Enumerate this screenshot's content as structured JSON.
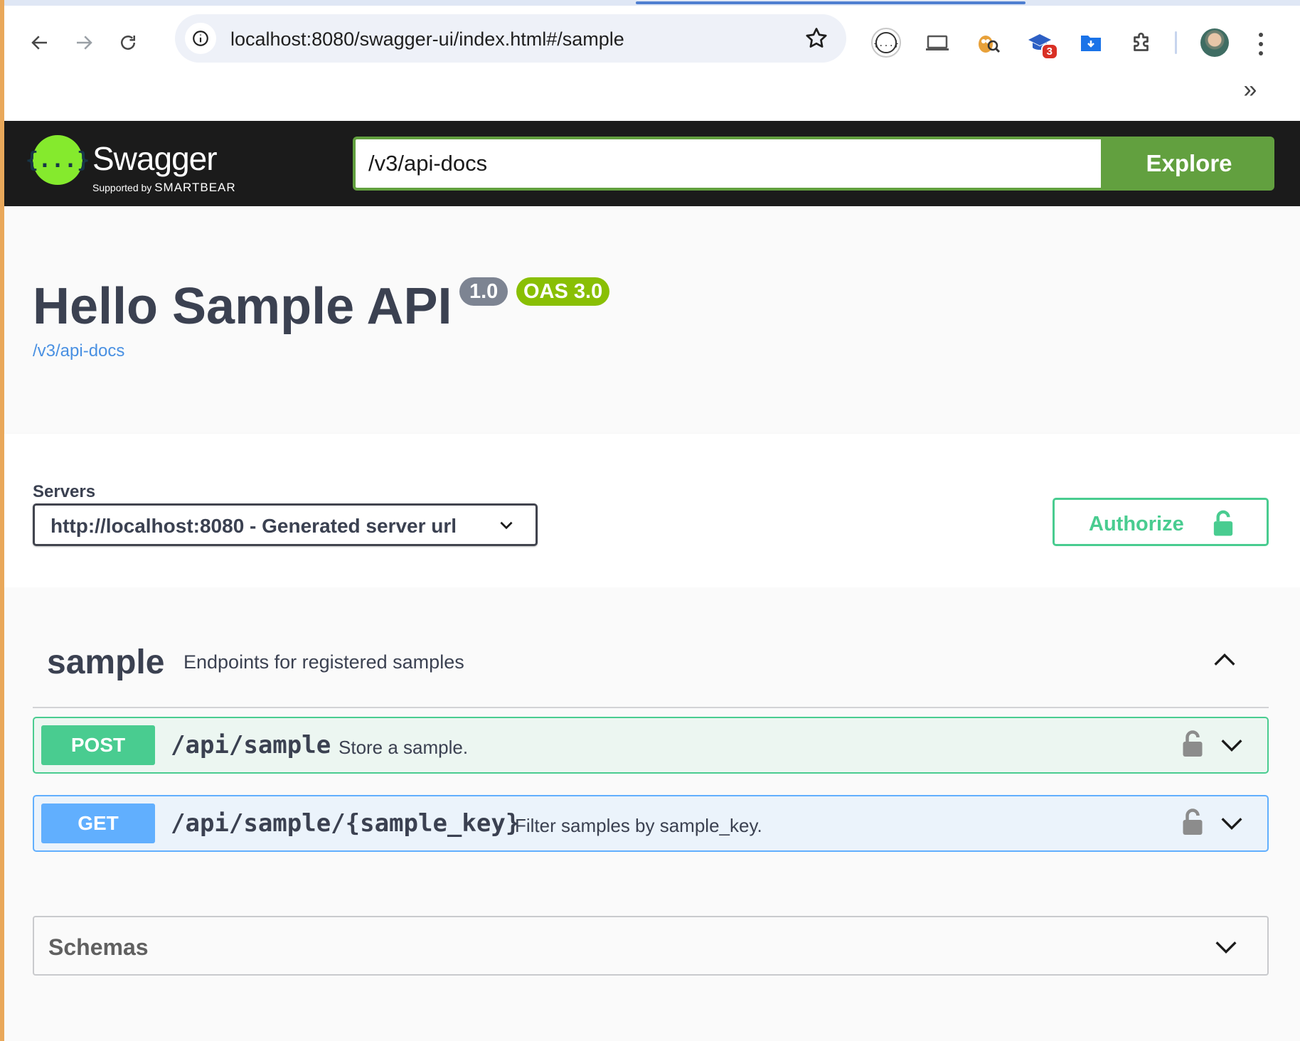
{
  "browser": {
    "url": "localhost:8080/swagger-ui/index.html#/sample",
    "extension_badge": "3",
    "overflow_label": "»"
  },
  "swagger_header": {
    "brand": "Swagger",
    "supported_by": "Supported by",
    "smartbear": "SMARTBEAR",
    "logo_glyph": "{...}",
    "spec_url": "/v3/api-docs",
    "explore_label": "Explore"
  },
  "info": {
    "title": "Hello Sample API",
    "version": "1.0",
    "oas_version": "OAS 3.0",
    "spec_link": "/v3/api-docs"
  },
  "servers": {
    "label": "Servers",
    "selected": "http://localhost:8080 - Generated server url",
    "authorize_label": "Authorize"
  },
  "tag": {
    "name": "sample",
    "description": "Endpoints for registered samples"
  },
  "operations": [
    {
      "method": "POST",
      "path": "/api/sample",
      "summary": "Store a sample."
    },
    {
      "method": "GET",
      "path": "/api/sample/{sample_key}",
      "summary": "Filter samples by sample_key."
    }
  ],
  "schemas": {
    "label": "Schemas"
  },
  "colors": {
    "post": "#49cc90",
    "get": "#61affe",
    "swagger_green": "#62a03f",
    "topbar": "#1b1b1b"
  }
}
